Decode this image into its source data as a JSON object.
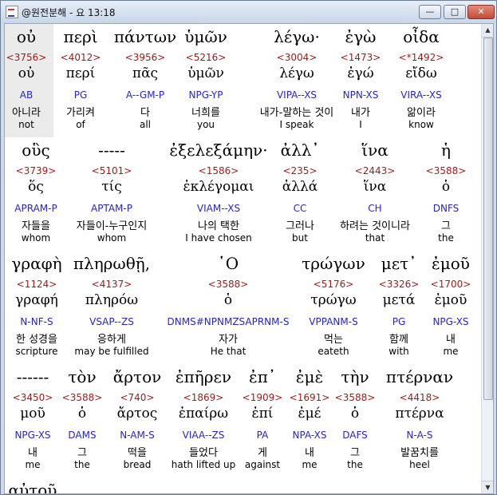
{
  "window": {
    "title": "@원전분해 - 요 13:18",
    "minimize_label": "—",
    "maximize_label": "□",
    "close_label": "✕"
  },
  "rows": [
    {
      "words": [
        {
          "greek": "οὐ",
          "num": "<3756>",
          "lemma": "οὐ",
          "parse": "AB",
          "kor": "아니라",
          "eng": "not"
        },
        {
          "greek": "περὶ",
          "num": "<4012>",
          "lemma": "περί",
          "parse": "PG",
          "kor": "가리켜",
          "eng": "of"
        },
        {
          "greek": "πάντων",
          "num": "<3956>",
          "lemma": "πᾶς",
          "parse": "A--GM-P",
          "kor": "다",
          "eng": "all"
        },
        {
          "greek": "ὑμῶν",
          "num": "<5216>",
          "lemma": "ὑμῶν",
          "parse": "NPG-YP",
          "kor": "너희를",
          "eng": "you"
        },
        {
          "greek": "λέγω·",
          "num": "<3004>",
          "lemma": "λέγω",
          "parse": "VIPA--XS",
          "kor": "내가-말하는 것이",
          "eng": "I speak"
        },
        {
          "greek": "ἐγὼ",
          "num": "<1473>",
          "lemma": "ἐγώ",
          "parse": "NPN-XS",
          "kor": "내가",
          "eng": "I"
        },
        {
          "greek": "οἶδα",
          "num": "<*1492>",
          "lemma": "εἴδω",
          "parse": "VIRA--XS",
          "kor": "앎이라",
          "eng": "know"
        }
      ]
    },
    {
      "words": [
        {
          "greek": "οὓς",
          "num": "<3739>",
          "lemma": "ὅς",
          "parse": "APRAM-P",
          "kor": "자들을",
          "eng": "whom"
        },
        {
          "greek": "-----",
          "num": "<5101>",
          "lemma": "τίς",
          "parse": "APTAM-P",
          "kor": "자들이-누구인지",
          "eng": "whom"
        },
        {
          "greek": "ἐξελεξάμην·",
          "num": "<1586>",
          "lemma": "ἐκλέγομαι",
          "parse": "VIAM--XS",
          "kor": "나의 택한",
          "eng": "I have chosen"
        },
        {
          "greek": "ἀλλ᾽",
          "num": "<235>",
          "lemma": "ἀλλά",
          "parse": "CC",
          "kor": "그러나",
          "eng": "but"
        },
        {
          "greek": "ἵνα",
          "num": "<2443>",
          "lemma": "ἵνα",
          "parse": "CH",
          "kor": "하려는 것이니라",
          "eng": "that"
        },
        {
          "greek": "ἡ",
          "num": "<3588>",
          "lemma": "ὁ",
          "parse": "DNFS",
          "kor": "그",
          "eng": "the"
        }
      ]
    },
    {
      "words": [
        {
          "greek": "γραφὴ",
          "num": "<1124>",
          "lemma": "γραφή",
          "parse": "N-NF-S",
          "kor": "한 성경을",
          "eng": "scripture"
        },
        {
          "greek": "πληρωθῇ,",
          "num": "<4137>",
          "lemma": "πληρόω",
          "parse": "VSAP--ZS",
          "kor": "응하게",
          "eng": "may be fulfilled"
        },
        {
          "greek": "῾Ο",
          "num": "<3588>",
          "lemma": "ὁ",
          "parse": "DNMS#NPNMZSAPRNM-S",
          "kor": "자가",
          "eng": "He that"
        },
        {
          "greek": "τρώγων",
          "num": "<5176>",
          "lemma": "τρώγω",
          "parse": "VPPANM-S",
          "kor": "먹는",
          "eng": "eateth"
        },
        {
          "greek": "μετ᾽",
          "num": "<3326>",
          "lemma": "μετά",
          "parse": "PG",
          "kor": "함께",
          "eng": "with"
        },
        {
          "greek": "ἐμοῦ",
          "num": "<1700>",
          "lemma": "ἐμοῦ",
          "parse": "NPG-XS",
          "kor": "내",
          "eng": "me"
        }
      ]
    },
    {
      "words": [
        {
          "greek": "------",
          "num": "<3450>",
          "lemma": "μοῦ",
          "parse": "NPG-XS",
          "kor": "내",
          "eng": "me"
        },
        {
          "greek": "τὸν",
          "num": "<3588>",
          "lemma": "ὁ",
          "parse": "DAMS",
          "kor": "그",
          "eng": "the"
        },
        {
          "greek": "ἄρτον",
          "num": "<740>",
          "lemma": "ἄρτος",
          "parse": "N-AM-S",
          "kor": "떡을",
          "eng": "bread"
        },
        {
          "greek": "ἐπῆρεν",
          "num": "<1869>",
          "lemma": "ἐπαίρω",
          "parse": "VIAA--ZS",
          "kor": "들었다",
          "eng": "hath lifted up"
        },
        {
          "greek": "ἐπ᾽",
          "num": "<1909>",
          "lemma": "ἐπί",
          "parse": "PA",
          "kor": "게",
          "eng": "against"
        },
        {
          "greek": "ἐμὲ",
          "num": "<1691>",
          "lemma": "ἐμέ",
          "parse": "NPA-XS",
          "kor": "내",
          "eng": "me"
        },
        {
          "greek": "τὴν",
          "num": "<3588>",
          "lemma": "ὁ",
          "parse": "DAFS",
          "kor": "그",
          "eng": "the"
        },
        {
          "greek": "πτέρναν",
          "num": "<4418>",
          "lemma": "πτέρνα",
          "parse": "N-A-S",
          "kor": "발꿈치를",
          "eng": "heel"
        }
      ]
    },
    {
      "words": [
        {
          "greek": "αὐτοῦ"
        }
      ]
    }
  ]
}
